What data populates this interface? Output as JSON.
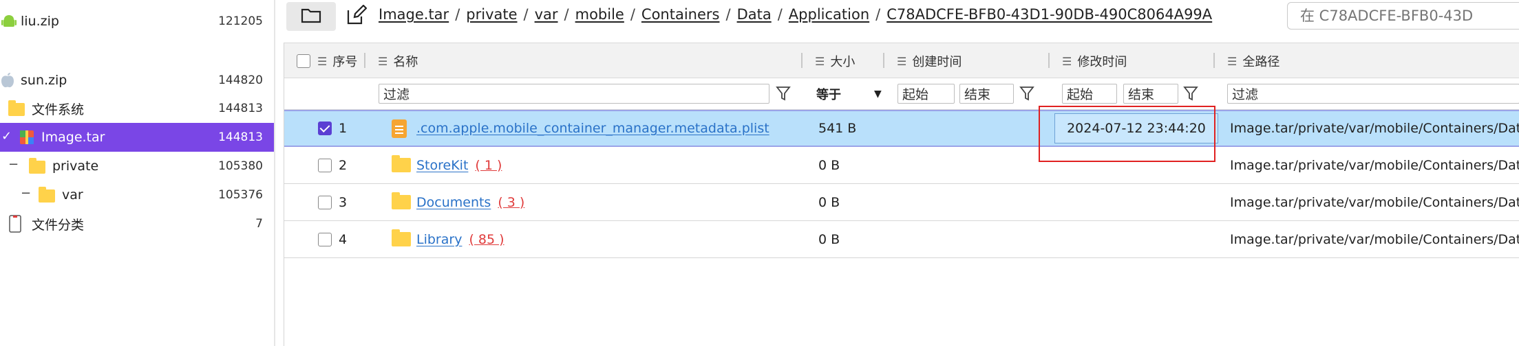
{
  "tree": {
    "items": [
      {
        "label": "liu.zip",
        "count": "121205",
        "icon": "android-icon"
      },
      {
        "label": "sun.zip",
        "count": "144820",
        "icon": "apple-icon"
      },
      {
        "label": "文件系统",
        "count": "144813",
        "icon": "folder-icon"
      },
      {
        "label": "Image.tar",
        "count": "144813",
        "icon": "archive-icon",
        "selected": true,
        "toggle": "✓"
      },
      {
        "label": "private",
        "count": "105380",
        "icon": "folder-icon",
        "toggle": "−"
      },
      {
        "label": "var",
        "count": "105376",
        "icon": "folder-icon",
        "toggle": "−"
      },
      {
        "label": "文件分类",
        "count": "7",
        "icon": "phone-icon"
      }
    ]
  },
  "pathbar": {
    "crumbs": [
      "Image.tar",
      "private",
      "var",
      "mobile",
      "Containers",
      "Data",
      "Application",
      "C78ADCFE-BFB0-43D1-90DB-490C8064A99A"
    ],
    "separator": "/",
    "search_placeholder": "在 C78ADCFE-BFB0-43D"
  },
  "table": {
    "headers": {
      "index": "序号",
      "name": "名称",
      "size": "大小",
      "created": "创建时间",
      "modified": "修改时间",
      "fullpath": "全路径"
    },
    "filters": {
      "name_placeholder": "过滤",
      "size_op": "等于",
      "created_start": "起始",
      "created_end": "结束",
      "modified_start": "起始",
      "modified_end": "结束",
      "fullpath_placeholder": "过滤"
    },
    "rows": [
      {
        "index": "1",
        "name": ".com.apple.mobile_container_manager.metadata.plist",
        "count": "",
        "size": "541 B",
        "modified": "2024-07-12 23:44:20",
        "path": "Image.tar/private/var/mobile/Containers/Data",
        "type": "file",
        "checked": true
      },
      {
        "index": "2",
        "name": "StoreKit",
        "count": "( 1 )",
        "size": "0 B",
        "modified": "",
        "path": "Image.tar/private/var/mobile/Containers/Data",
        "type": "folder",
        "checked": false
      },
      {
        "index": "3",
        "name": "Documents",
        "count": "( 3 )",
        "size": "0 B",
        "modified": "",
        "path": "Image.tar/private/var/mobile/Containers/Data",
        "type": "folder",
        "checked": false
      },
      {
        "index": "4",
        "name": "Library",
        "count": "( 85 )",
        "size": "0 B",
        "modified": "",
        "path": "Image.tar/private/var/mobile/Containers/Data",
        "type": "folder",
        "checked": false
      }
    ]
  },
  "colors": {
    "selected_tree": "#7a46e6",
    "selected_row": "#b9e0fb",
    "link": "#2a72c8",
    "count": "#e03b3b",
    "highlight": "#e02020"
  }
}
